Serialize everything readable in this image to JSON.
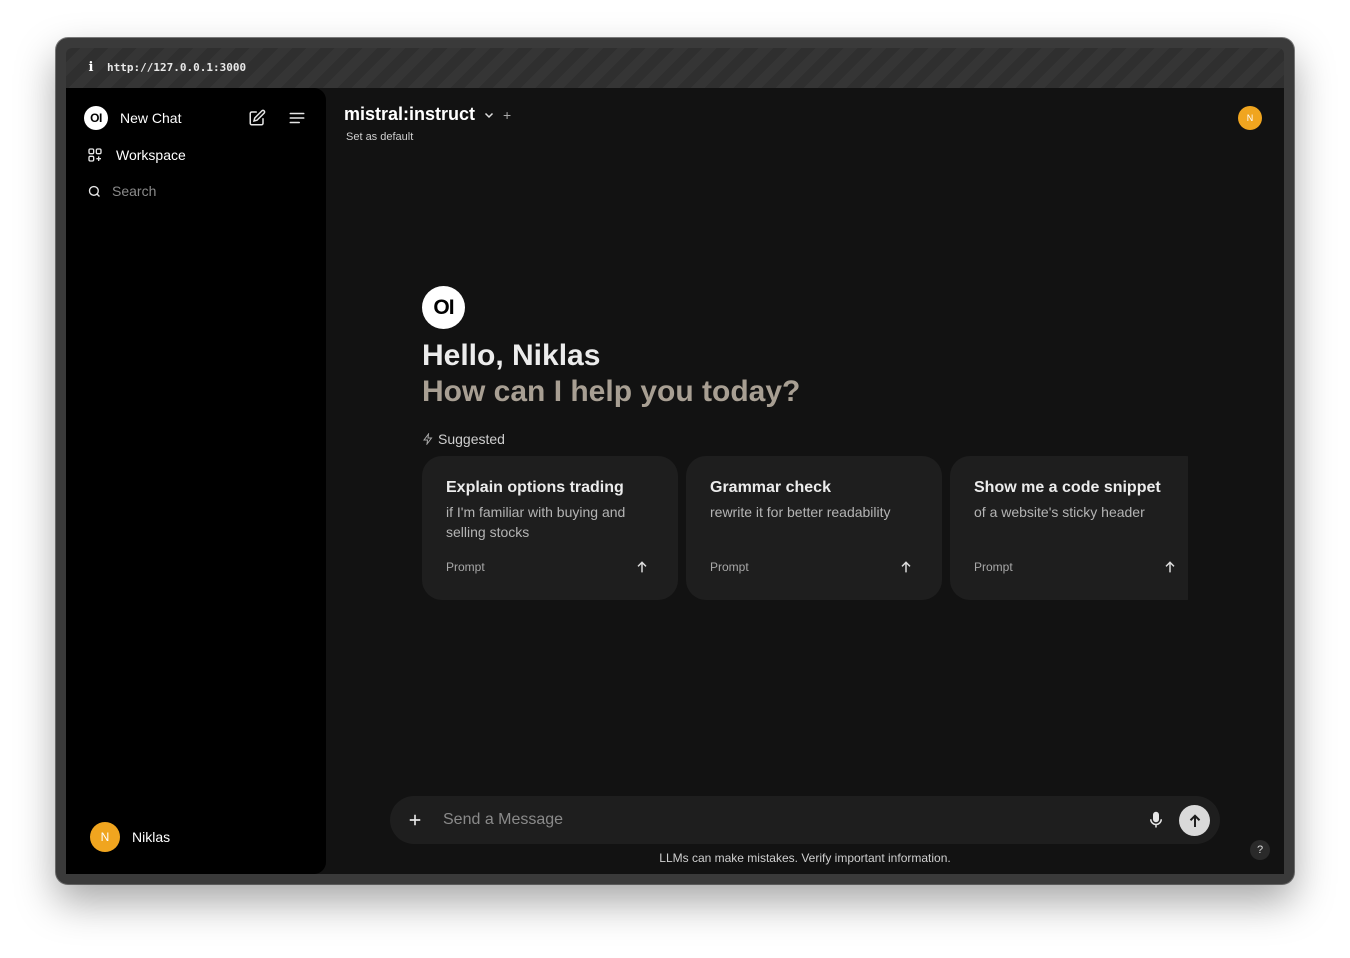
{
  "browser": {
    "info_glyph": "i",
    "url": "http://127.0.0.1:3000",
    "toolbar_icons": [
      "link-icon",
      "download-icon",
      "camera-icon",
      "terminal-icon",
      "globe-icon",
      "crosshair-icon",
      "extension-icon",
      "spy-icon",
      "sidebar-toggle-icon"
    ]
  },
  "sidebar": {
    "logo_text": "OI",
    "new_chat_label": "New Chat",
    "workspace_label": "Workspace",
    "search_placeholder": "Search",
    "user": {
      "initial": "N",
      "name": "Niklas"
    }
  },
  "header": {
    "model_name": "mistral:instruct",
    "set_default_label": "Set as default",
    "add_model_glyph": "+",
    "avatar_initial": "N"
  },
  "main": {
    "logo_text": "OI",
    "greeting": "Hello, Niklas",
    "subtitle": "How can I help you today?",
    "suggested_label": "Suggested",
    "suggestions": [
      {
        "title": "Explain options trading",
        "subtitle": "if I'm familiar with buying and selling stocks",
        "tag": "Prompt"
      },
      {
        "title": "Grammar check",
        "subtitle": "rewrite it for better readability",
        "tag": "Prompt"
      },
      {
        "title": "Show me a code snippet",
        "subtitle": "of a website's sticky header",
        "tag": "Prompt"
      }
    ]
  },
  "composer": {
    "placeholder": "Send a Message",
    "value": "",
    "disclaimer": "LLMs can make mistakes. Verify important information."
  },
  "help_glyph": "?",
  "colors": {
    "accent": "#f0a51f",
    "background": "#121212",
    "sidebar": "#000000",
    "card": "#1e1e1e",
    "subtitle": "#a89f93"
  }
}
